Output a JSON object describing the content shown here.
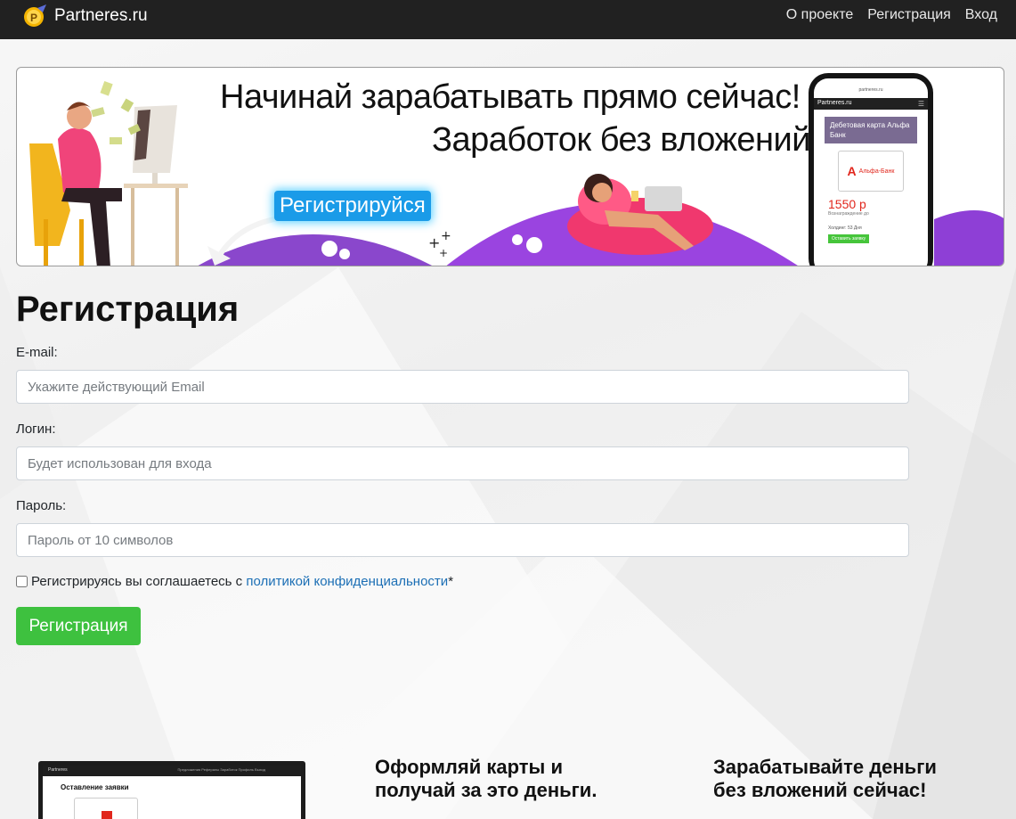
{
  "navbar": {
    "brand": "Partneres.ru",
    "links": [
      "О проекте",
      "Регистрация",
      "Вход"
    ]
  },
  "banner": {
    "line1": "Начинай зарабатывать прямо сейчас!",
    "line2": "Заработок без вложений",
    "cta": "Регистрируйся",
    "phone": {
      "url": "partneres.ru",
      "nav_brand": "Partneres.ru",
      "card_title": "Дебетовая карта Альфа Банк",
      "bank_logo": "Альфа-Банк",
      "price": "1550 р",
      "reward_caption": "Вознаграждение до",
      "hold": "Холдинг: 53 Дня",
      "button": "Оставить заявку"
    }
  },
  "form": {
    "title": "Регистрация",
    "email_label": "E-mail:",
    "email_placeholder": "Укажите действующий Email",
    "login_label": "Логин:",
    "login_placeholder": "Будет использован для входа",
    "password_label": "Пароль:",
    "password_placeholder": "Пароль от 10 символов",
    "agree_text": "Регистрируясь вы соглашаетесь с",
    "agree_link": "политикой конфиденциальности",
    "agree_suffix": "*",
    "submit": "Регистрация"
  },
  "promo": {
    "shot_brand": "Partneres",
    "shot_links": "Предложения   Рефералы   Заработок   Профиль   Выход",
    "shot_title": "Оставление заявки",
    "heading1_line1": "Оформляй карты и",
    "heading1_line2": "получай за это деньги.",
    "heading2_line1": "Зарабатывайте деньги",
    "heading2_line2": "без вложений сейчас!"
  },
  "colors": {
    "navbar_bg": "#212121",
    "submit_green": "#3ec13f",
    "link_blue": "#1c6fb5",
    "cta_blue": "#1a9be8",
    "banner_purple": "#8e3fd6"
  }
}
